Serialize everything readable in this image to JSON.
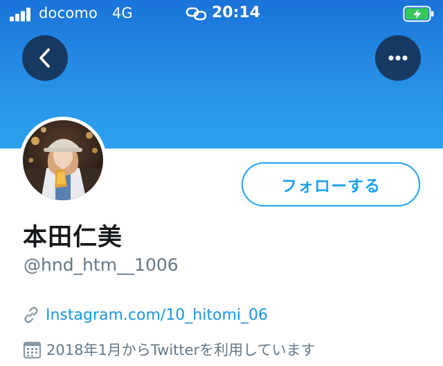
{
  "status_bar": {
    "carrier": "docomo",
    "network": "4G",
    "time": "20:14",
    "icons": [
      "signal-icon",
      "link-status-icon",
      "battery-charging-icon"
    ]
  },
  "header": {
    "back_icon": "chevron-left-icon",
    "more_icon": "more-horizontal-icon"
  },
  "profile": {
    "display_name": "本田仁美",
    "handle": "@hnd_htm__1006",
    "follow_label": "フォローする",
    "website": "Instagram.com/10_hitomi_06",
    "website_icon": "link-icon",
    "joined": "2018年1月からTwitterを利用しています",
    "joined_icon": "calendar-icon"
  },
  "colors": {
    "banner_top": "#1a73d9",
    "banner_bottom": "#2aa0ee",
    "accent": "#1da1f2",
    "link": "#1b95e0",
    "secondary_text": "#657786",
    "primary_text": "#14171a"
  }
}
